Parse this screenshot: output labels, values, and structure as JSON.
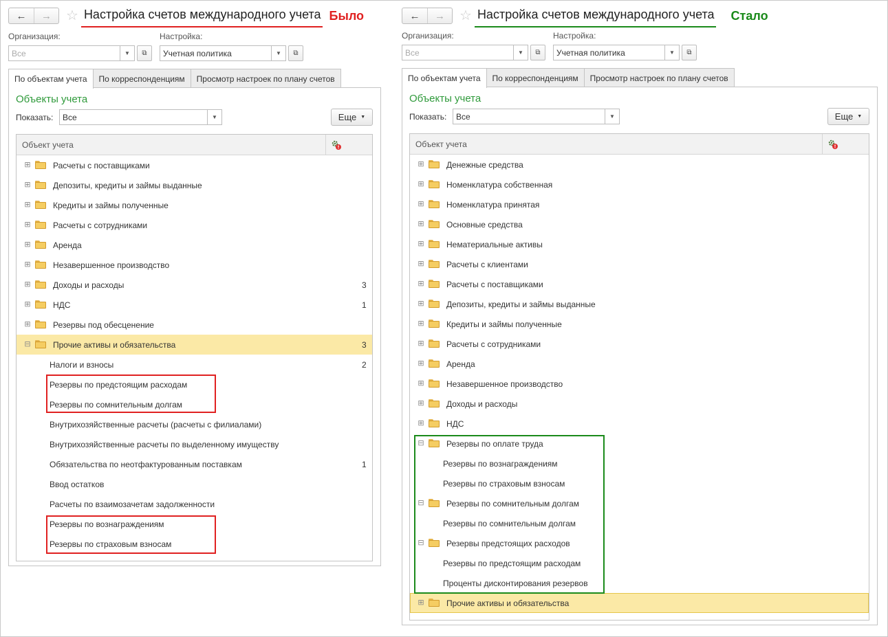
{
  "shared": {
    "org_label": "Организация:",
    "org_placeholder": "Все",
    "setting_label": "Настройка:",
    "setting_value": "Учетная политика",
    "tabs": [
      "По объектам учета",
      "По корреспонденциям",
      "Просмотр настроек по плану счетов"
    ],
    "section_title": "Объекты учета",
    "show_label": "Показать:",
    "show_value": "Все",
    "more_label": "Еще",
    "column_header": "Объект учета",
    "window_title": "Настройка счетов международного учета"
  },
  "left": {
    "tag": "Было",
    "rows": [
      {
        "label": "Расчеты с поставщиками",
        "type": "folder",
        "expand": "plus",
        "count": ""
      },
      {
        "label": "Депозиты, кредиты и займы выданные",
        "type": "folder",
        "expand": "plus",
        "count": ""
      },
      {
        "label": "Кредиты и займы полученные",
        "type": "folder",
        "expand": "plus",
        "count": ""
      },
      {
        "label": "Расчеты с сотрудниками",
        "type": "folder",
        "expand": "plus",
        "count": ""
      },
      {
        "label": "Аренда",
        "type": "folder",
        "expand": "plus",
        "count": ""
      },
      {
        "label": "Незавершенное производство",
        "type": "folder",
        "expand": "plus",
        "count": ""
      },
      {
        "label": "Доходы и расходы",
        "type": "folder",
        "expand": "plus",
        "count": "3"
      },
      {
        "label": "НДС",
        "type": "folder",
        "expand": "plus",
        "count": "1"
      },
      {
        "label": "Резервы под обесценение",
        "type": "folder",
        "expand": "plus",
        "count": ""
      },
      {
        "label": "Прочие активы и обязательства",
        "type": "folder",
        "expand": "minus",
        "count": "3"
      },
      {
        "label": "Налоги и взносы",
        "type": "child",
        "expand": "",
        "count": "2"
      },
      {
        "label": "Резервы по предстоящим расходам",
        "type": "child",
        "expand": "",
        "count": ""
      },
      {
        "label": "Резервы по сомнительным долгам",
        "type": "child",
        "expand": "",
        "count": ""
      },
      {
        "label": "Внутрихозяйственные расчеты (расчеты с филиалами)",
        "type": "child",
        "expand": "",
        "count": ""
      },
      {
        "label": "Внутрихозяйственные расчеты по выделенному имуществу",
        "type": "child",
        "expand": "",
        "count": ""
      },
      {
        "label": "Обязательства по неотфактурованным поставкам",
        "type": "child",
        "expand": "",
        "count": "1"
      },
      {
        "label": "Ввод остатков",
        "type": "child",
        "expand": "",
        "count": ""
      },
      {
        "label": "Расчеты по взаимозачетам задолженности",
        "type": "child",
        "expand": "",
        "count": ""
      },
      {
        "label": "Резервы по вознаграждениям",
        "type": "child",
        "expand": "",
        "count": ""
      },
      {
        "label": "Резервы по страховым взносам",
        "type": "child",
        "expand": "",
        "count": ""
      }
    ]
  },
  "right": {
    "tag": "Стало",
    "rows": [
      {
        "label": "Денежные средства",
        "type": "folder",
        "expand": "plus"
      },
      {
        "label": "Номенклатура собственная",
        "type": "folder",
        "expand": "plus"
      },
      {
        "label": "Номенклатура принятая",
        "type": "folder",
        "expand": "plus"
      },
      {
        "label": "Основные средства",
        "type": "folder",
        "expand": "plus"
      },
      {
        "label": "Нематериальные активы",
        "type": "folder",
        "expand": "plus"
      },
      {
        "label": "Расчеты с клиентами",
        "type": "folder",
        "expand": "plus"
      },
      {
        "label": "Расчеты с поставщиками",
        "type": "folder",
        "expand": "plus"
      },
      {
        "label": "Депозиты, кредиты и займы выданные",
        "type": "folder",
        "expand": "plus"
      },
      {
        "label": "Кредиты и займы полученные",
        "type": "folder",
        "expand": "plus"
      },
      {
        "label": "Расчеты с сотрудниками",
        "type": "folder",
        "expand": "plus"
      },
      {
        "label": "Аренда",
        "type": "folder",
        "expand": "plus"
      },
      {
        "label": "Незавершенное производство",
        "type": "folder",
        "expand": "plus"
      },
      {
        "label": "Доходы и расходы",
        "type": "folder",
        "expand": "plus"
      },
      {
        "label": "НДС",
        "type": "folder",
        "expand": "plus"
      },
      {
        "label": "Резервы по оплате труда",
        "type": "folder",
        "expand": "minus"
      },
      {
        "label": "Резервы по вознаграждениям",
        "type": "child",
        "expand": ""
      },
      {
        "label": "Резервы по страховым взносам",
        "type": "child",
        "expand": ""
      },
      {
        "label": "Резервы по сомнительным долгам",
        "type": "folder",
        "expand": "minus"
      },
      {
        "label": "Резервы по сомнительным долгам",
        "type": "child",
        "expand": ""
      },
      {
        "label": "Резервы предстоящих расходов",
        "type": "folder",
        "expand": "minus"
      },
      {
        "label": "Резервы по предстоящим расходам",
        "type": "child",
        "expand": ""
      },
      {
        "label": "Проценты дисконтирования резервов",
        "type": "child",
        "expand": ""
      },
      {
        "label": "Прочие активы и обязательства",
        "type": "folder",
        "expand": "plus"
      }
    ]
  },
  "colors": {
    "red": "#e02020",
    "green": "#1a8a1a",
    "section_green": "#2f9a3b",
    "selected_row": "#fbe9a6"
  },
  "icons": [
    "back-arrow-icon",
    "forward-arrow-icon",
    "star-icon",
    "dropdown-arrow-icon",
    "open-form-icon",
    "folder-icon",
    "expand-plus-icon",
    "collapse-minus-icon",
    "settings-gear-icon"
  ]
}
